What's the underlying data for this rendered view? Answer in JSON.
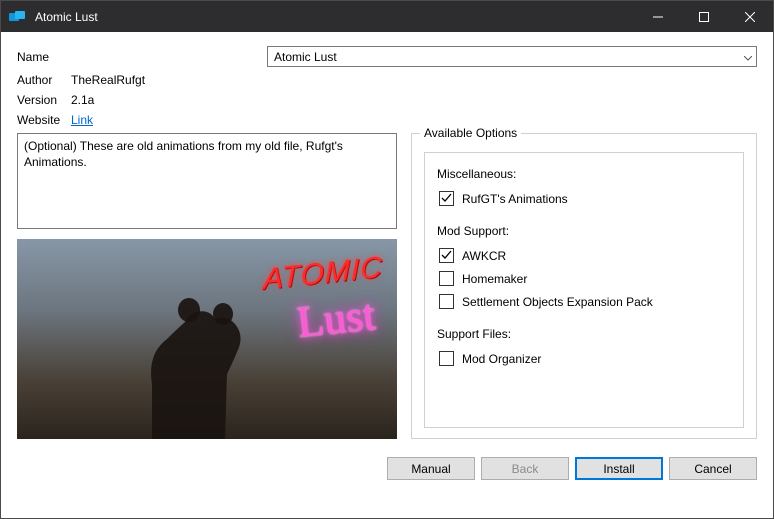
{
  "window": {
    "title": "Atomic Lust"
  },
  "meta": {
    "name_label": "Name",
    "name_value": "Atomic Lust",
    "author_label": "Author",
    "author_value": "TheRealRufgt",
    "version_label": "Version",
    "version_value": "2.1a",
    "website_label": "Website",
    "website_value": "Link"
  },
  "description": "(Optional) These are old animations from my old file, Rufgt's Animations.",
  "image": {
    "logo_top": "ATOMIC",
    "logo_bottom": "Lust"
  },
  "options": {
    "legend": "Available Options",
    "sections": [
      {
        "label": "Miscellaneous:",
        "items": [
          {
            "label": "RufGT's Animations",
            "checked": true
          }
        ]
      },
      {
        "label": "Mod Support:",
        "items": [
          {
            "label": "AWKCR",
            "checked": true
          },
          {
            "label": "Homemaker",
            "checked": false
          },
          {
            "label": "Settlement Objects Expansion Pack",
            "checked": false
          }
        ]
      },
      {
        "label": "Support Files:",
        "items": [
          {
            "label": "Mod Organizer",
            "checked": false
          }
        ]
      }
    ]
  },
  "buttons": {
    "manual": "Manual",
    "back": "Back",
    "install": "Install",
    "cancel": "Cancel"
  }
}
